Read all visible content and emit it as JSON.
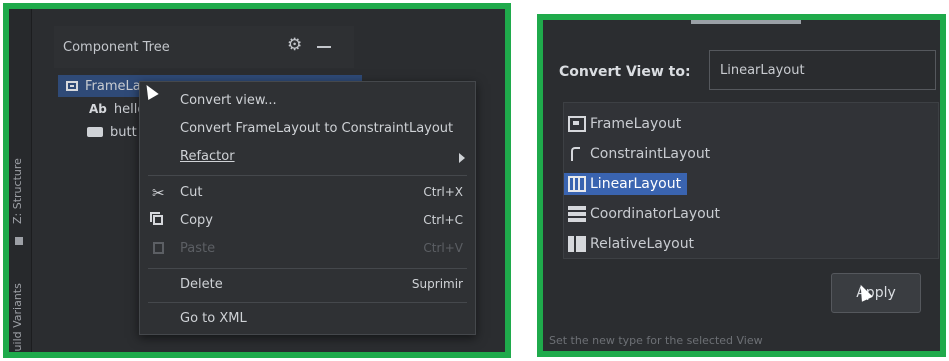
{
  "left": {
    "side_tabs": [
      "Z: Structure",
      "Build Variants"
    ],
    "tree": {
      "title": "Component Tree",
      "items": [
        {
          "label": "FrameLa",
          "icon": "framelayout-icon"
        },
        {
          "label": "hello",
          "icon": "textview-icon",
          "icon_text": "Ab"
        },
        {
          "label": "butt",
          "icon": "button-icon"
        }
      ]
    },
    "menu": {
      "items": [
        {
          "label": "Convert view...",
          "shortcut": ""
        },
        {
          "label": "Convert FrameLayout to ConstraintLayout",
          "shortcut": ""
        },
        {
          "label": "Refactor",
          "shortcut": "",
          "submenu": true
        },
        {
          "label": "Cut",
          "shortcut": "Ctrl+X",
          "icon": "scissors-icon"
        },
        {
          "label": "Copy",
          "shortcut": "Ctrl+C",
          "icon": "copy-icon"
        },
        {
          "label": "Paste",
          "shortcut": "Ctrl+V",
          "icon": "paste-icon",
          "disabled": true
        },
        {
          "label": "Delete",
          "shortcut": "Suprimir"
        },
        {
          "label": "Go to XML",
          "shortcut": ""
        }
      ]
    }
  },
  "right": {
    "label": "Convert View to:",
    "input_value": "LinearLayout",
    "options": [
      {
        "label": "FrameLayout",
        "icon": "framelayout-icon"
      },
      {
        "label": "ConstraintLayout",
        "icon": "constraintlayout-icon"
      },
      {
        "label": "LinearLayout",
        "icon": "linearlayout-icon",
        "selected": true
      },
      {
        "label": "CoordinatorLayout",
        "icon": "coordinatorlayout-icon"
      },
      {
        "label": "RelativeLayout",
        "icon": "relativelayout-icon"
      }
    ],
    "apply_label": "Apply",
    "status": "Set the new type for the selected View"
  },
  "colors": {
    "border": "#1faa4b",
    "background": "#2b2d30",
    "selection": "#3a64b0"
  }
}
